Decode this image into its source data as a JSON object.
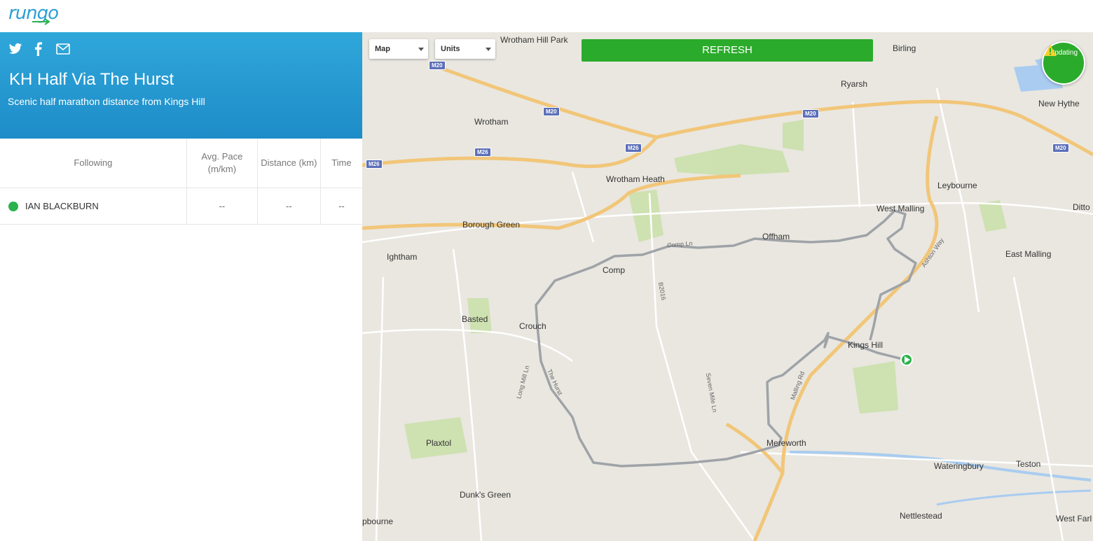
{
  "app": {
    "logo_text": "rungo"
  },
  "share": {
    "icons": [
      "twitter-icon",
      "facebook-icon",
      "mail-icon"
    ]
  },
  "race": {
    "title": "KH Half Via The Hurst",
    "subtitle": "Scenic half marathon distance from Kings Hill"
  },
  "table": {
    "headers": {
      "following": "Following",
      "avg_pace": "Avg. Pace (m/km)",
      "distance": "Distance (km)",
      "time": "Time"
    },
    "rows": [
      {
        "name": "IAN BLACKBURN",
        "status_color": "#2bb24c",
        "avg_pace": "--",
        "distance": "--",
        "time": "--"
      }
    ]
  },
  "map": {
    "map_type_label": "Map",
    "units_label": "Units",
    "refresh_label": "REFRESH",
    "updating_label": "Updating",
    "labels": {
      "wrotham_hill_park": "Wrotham Hill Park",
      "birling": "Birling",
      "ryarsh": "Ryarsh",
      "new_hythe": "New Hythe",
      "wrotham": "Wrotham",
      "wrotham_heath": "Wrotham Heath",
      "leybourne": "Leybourne",
      "ditton": "Ditto",
      "west_malling": "West Malling",
      "borough_green": "Borough Green",
      "offham": "Offham",
      "ightham": "Ightham",
      "comp": "Comp",
      "east_malling": "East Malling",
      "basted": "Basted",
      "crouch": "Crouch",
      "kings_hill": "Kings Hill",
      "plaxtol": "Plaxtol",
      "mereworth": "Mereworth",
      "wateringbury": "Wateringbury",
      "teston": "Teston",
      "dunks_green": "Dunk's Green",
      "nettlestead": "Nettlestead",
      "hipbourne": "pbourne",
      "west_farleigh": "West Farl",
      "ashton_way": "Ashton Way",
      "malling_rd": "Malling Rd",
      "comp_ln": "Comp Ln",
      "seven_mile_ln": "Seven Mile Ln",
      "b2016": "B2016",
      "the_hurst": "The Hurst",
      "long_mill_ln": "Long Mill Ln"
    },
    "road_shields": [
      "M20",
      "M20",
      "M20",
      "M20",
      "M26",
      "M26",
      "M26"
    ]
  }
}
